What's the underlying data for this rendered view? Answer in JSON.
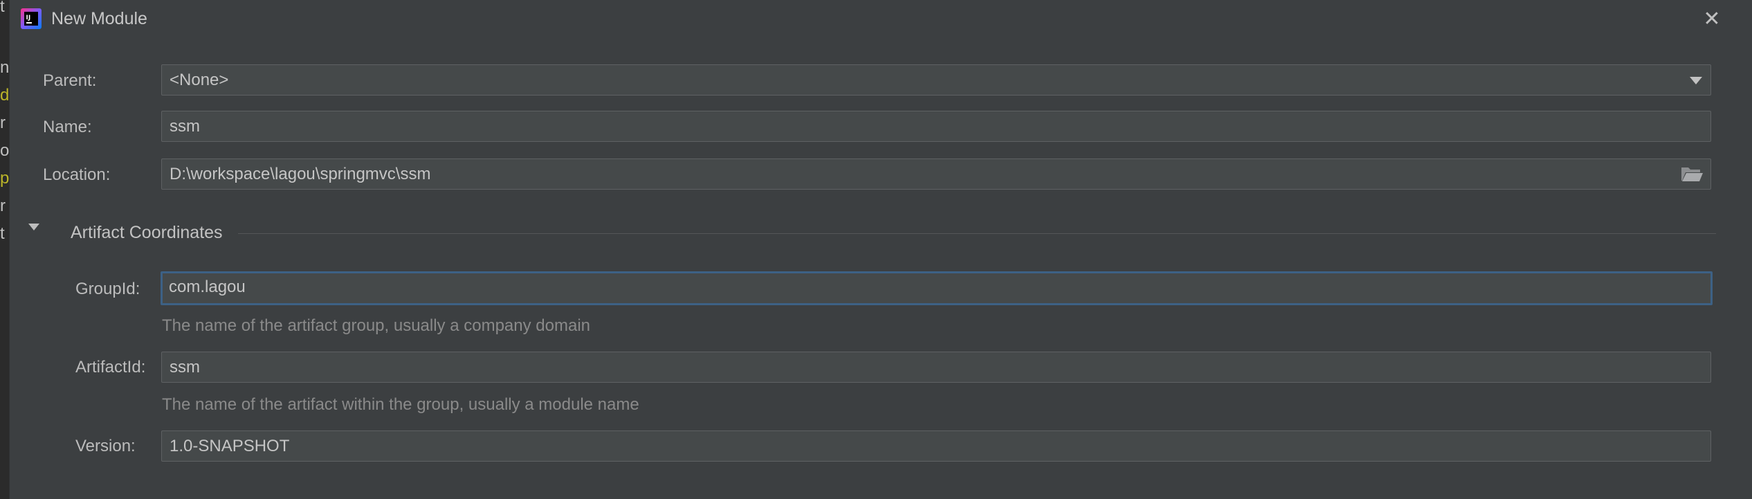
{
  "ide_background": {
    "fragments": [
      "t",
      "n",
      "d",
      "r",
      "o",
      "p",
      "r",
      "t"
    ]
  },
  "dialog": {
    "title": "New Module",
    "close_glyph": "✕"
  },
  "parent": {
    "label": "Parent:",
    "value": "<None>"
  },
  "name": {
    "label": "Name:",
    "value": "ssm"
  },
  "location": {
    "label": "Location:",
    "value": "D:\\workspace\\lagou\\springmvc\\ssm"
  },
  "artifact_section": {
    "title": "Artifact Coordinates",
    "expanded": true
  },
  "group_id": {
    "label": "GroupId:",
    "value": "com.lagou",
    "hint": "The name of the artifact group, usually a company domain"
  },
  "artifact_id": {
    "label": "ArtifactId:",
    "value": "ssm",
    "hint": "The name of the artifact within the group, usually a module name"
  },
  "version": {
    "label": "Version:",
    "value": "1.0-SNAPSHOT"
  },
  "colors": {
    "dialog_bg": "#3c3f41",
    "field_bg": "#45494a",
    "focus_border": "#3d6185",
    "hint_text": "#8a8a8a"
  },
  "icons": {
    "app": "intellij-idea-icon",
    "close": "close-icon",
    "dropdown": "chevron-down-icon",
    "browse": "folder-icon",
    "section": "expand-triangle-icon"
  }
}
